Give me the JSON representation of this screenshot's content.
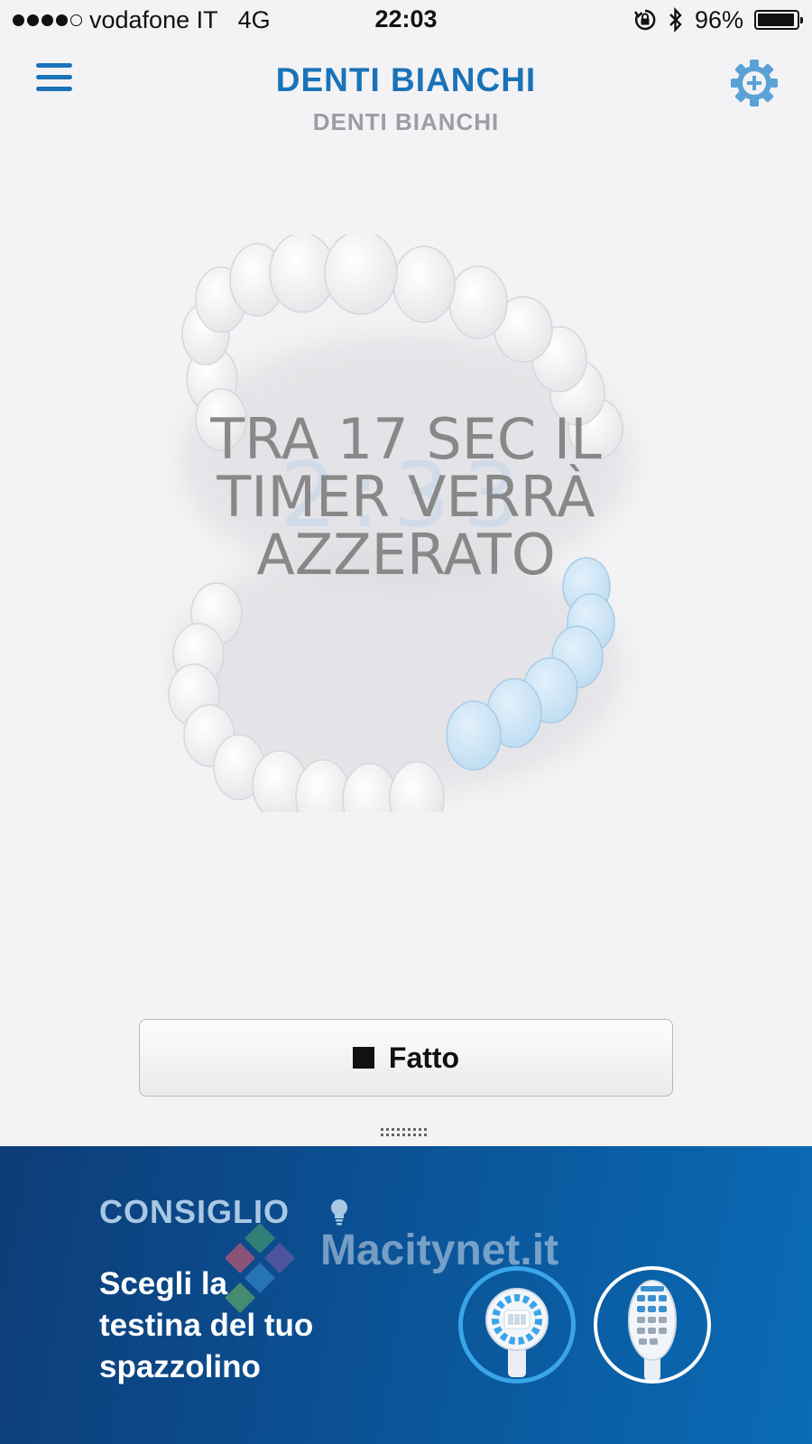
{
  "status_bar": {
    "carrier": "vodafone IT",
    "network": "4G",
    "time": "22:03",
    "battery": "96%",
    "battery_level": 0.96,
    "signal_bars": 4
  },
  "header": {
    "title": "DENTI BIANCHI",
    "subtitle": "DENTI BIANCHI",
    "menu_icon": "hamburger-menu-icon",
    "settings_icon": "gear-plus-icon"
  },
  "timer": {
    "digits": "2:33",
    "message_lines": [
      "TRA 17 SEC IL",
      "TIMER VERRÀ",
      "AZZERATO"
    ]
  },
  "done_button": {
    "label": "Fatto",
    "icon": "stop-square-icon"
  },
  "tip": {
    "heading": "CONSIGLIO",
    "heading_icon": "lightbulb-icon",
    "text_lines": [
      "Scegli la",
      "testina del tuo",
      "spazzolino"
    ],
    "watermark": "Macitynet.it"
  },
  "colors": {
    "accent": "#1a73b8",
    "subtitle_gray": "#9c9ca2",
    "panel_dark": "#0d3d78",
    "panel_light": "#0a6cb6",
    "highlight_teeth": "#cde5f6",
    "selected_ring": "#3aa5e8"
  }
}
